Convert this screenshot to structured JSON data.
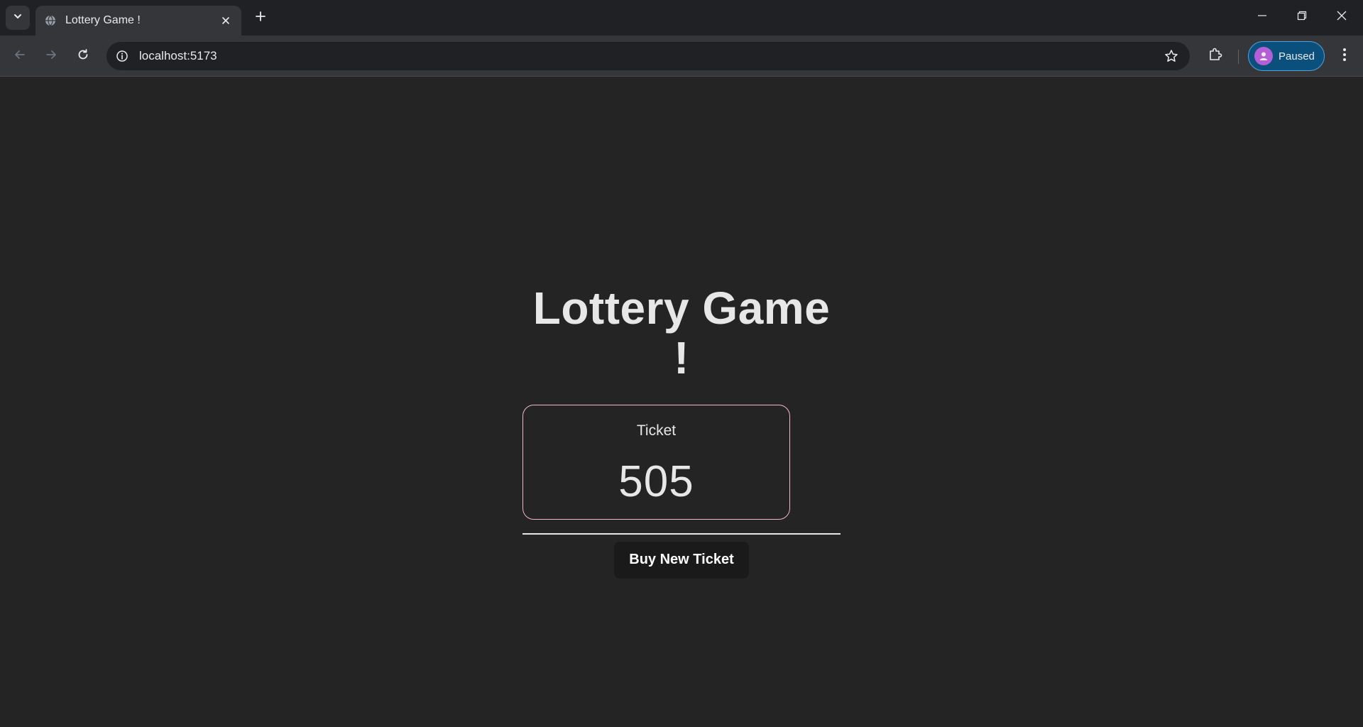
{
  "browser": {
    "tab": {
      "title": "Lottery Game !"
    },
    "address_bar": {
      "url": "localhost:5173"
    },
    "profile": {
      "label": "Paused"
    },
    "icons": {
      "tab_search": "chevron-down-icon",
      "favicon": "globe-icon",
      "tab_close": "close-icon",
      "new_tab": "plus-icon",
      "minimize": "minimize-icon",
      "restore": "restore-icon",
      "close_window": "close-icon",
      "back": "arrow-left-icon",
      "forward": "arrow-right-icon",
      "reload": "reload-icon",
      "site_info": "info-icon",
      "bookmark": "star-icon",
      "extensions": "puzzle-icon",
      "menu": "kebab-menu-icon"
    }
  },
  "page": {
    "title": "Lottery Game !",
    "ticket": {
      "label": "Ticket",
      "number": "505"
    },
    "buy_button": {
      "label": "Buy New Ticket"
    }
  },
  "colors": {
    "page_background": "#242424",
    "card_border": "#f2b6c6",
    "button_background": "#1a1a1a",
    "profile_chip": "#0b4f7d"
  }
}
